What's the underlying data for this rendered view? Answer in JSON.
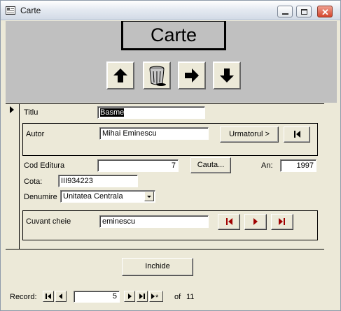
{
  "window": {
    "title": "Carte"
  },
  "header": {
    "caption": "Carte"
  },
  "toolbar": {
    "up_icon": "arrow-up-icon",
    "delete_icon": "trash-icon",
    "next_icon": "arrow-right-icon",
    "down_icon": "arrow-down-icon"
  },
  "fields": {
    "titlu_label": "Titlu",
    "titlu_value": "Basme",
    "autor_label": "Autor",
    "autor_value": "Mihai Eminescu",
    "urmatorul_button": "Urmatorul >",
    "cod_editura_label": "Cod Editura",
    "cod_editura_value": "7",
    "cauta_button": "Cauta...",
    "an_label": "An:",
    "an_value": "1997",
    "cota_label": "Cota:",
    "cota_value": "III934223",
    "denumire_label": "Denumire",
    "denumire_value": "Unitatea Centrala",
    "cuvant_cheie_label": "Cuvant cheie",
    "cuvant_cheie_value": "eminescu"
  },
  "footer": {
    "inchide_button": "Inchide"
  },
  "record_nav": {
    "label": "Record:",
    "current": "5",
    "of_label": "of",
    "total": "11"
  }
}
